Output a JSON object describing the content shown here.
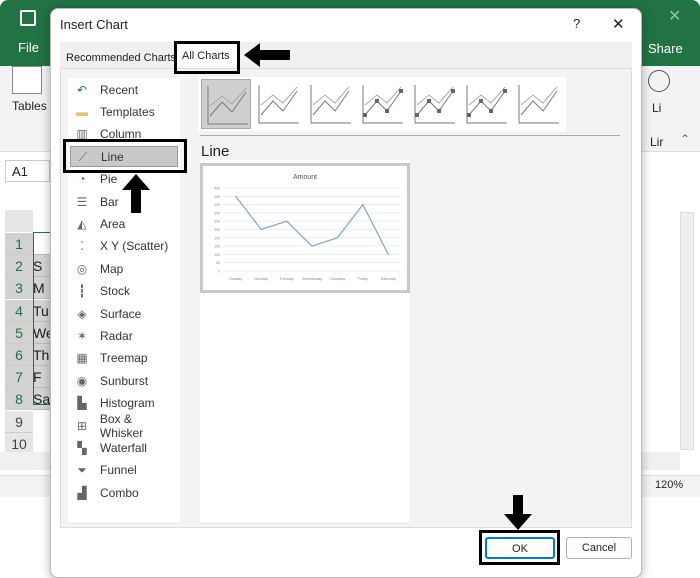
{
  "excel": {
    "file_tab": "File",
    "share": "Share",
    "tables_label": "Tables",
    "link_label": "Li",
    "links_group": "Lir",
    "name_box": "A1",
    "rows": [
      "1",
      "2",
      "3",
      "4",
      "5",
      "6",
      "7",
      "8",
      "9",
      "10"
    ],
    "cells": [
      "",
      "S",
      "M",
      "Tu",
      "We",
      "Th",
      "F",
      "Sa"
    ],
    "zoom": "120%",
    "accent": "#217346"
  },
  "dialog": {
    "title": "Insert Chart",
    "help": "?",
    "close": "✕",
    "tabs": [
      {
        "label": "Recommended Charts"
      },
      {
        "label": "All Charts"
      }
    ],
    "categories": [
      {
        "label": "Recent",
        "icon": "recent-icon"
      },
      {
        "label": "Templates",
        "icon": "folder-icon"
      },
      {
        "label": "Column",
        "icon": "column-chart-icon"
      },
      {
        "label": "Line",
        "icon": "line-chart-icon"
      },
      {
        "label": "Pie",
        "icon": "pie-chart-icon"
      },
      {
        "label": "Bar",
        "icon": "bar-chart-icon"
      },
      {
        "label": "Area",
        "icon": "area-chart-icon"
      },
      {
        "label": "X Y (Scatter)",
        "icon": "scatter-chart-icon"
      },
      {
        "label": "Map",
        "icon": "map-icon"
      },
      {
        "label": "Stock",
        "icon": "stock-chart-icon"
      },
      {
        "label": "Surface",
        "icon": "surface-chart-icon"
      },
      {
        "label": "Radar",
        "icon": "radar-chart-icon"
      },
      {
        "label": "Treemap",
        "icon": "treemap-icon"
      },
      {
        "label": "Sunburst",
        "icon": "sunburst-icon"
      },
      {
        "label": "Histogram",
        "icon": "histogram-icon"
      },
      {
        "label": "Box & Whisker",
        "icon": "box-whisker-icon"
      },
      {
        "label": "Waterfall",
        "icon": "waterfall-icon"
      },
      {
        "label": "Funnel",
        "icon": "funnel-icon"
      },
      {
        "label": "Combo",
        "icon": "combo-chart-icon"
      }
    ],
    "selected_category": "Line",
    "section_title": "Line",
    "ok": "OK",
    "cancel": "Cancel"
  },
  "chart_data": {
    "type": "line",
    "title": "Amount",
    "categories": [
      "Sunday",
      "Monday",
      "Tuesday",
      "Wednesday",
      "Thursday",
      "Friday",
      "Saturday"
    ],
    "values": [
      450,
      250,
      300,
      150,
      200,
      400,
      100
    ],
    "yticks": [
      "0",
      "50",
      "100",
      "150",
      "200",
      "250",
      "300",
      "350",
      "400",
      "450",
      "500"
    ],
    "ylim": [
      0,
      500
    ],
    "grid": true,
    "color": "#7ea6cf"
  }
}
